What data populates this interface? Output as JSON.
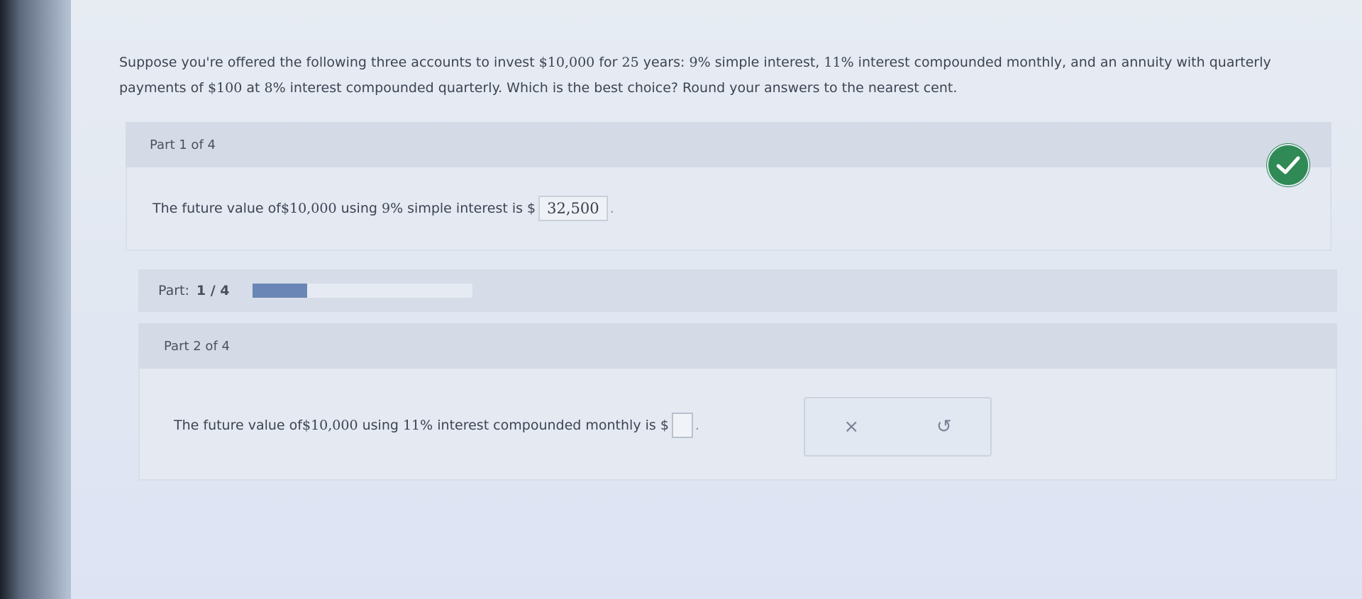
{
  "question": {
    "segments": [
      {
        "t": "Suppose you're offered the following three accounts to invest ",
        "n": false
      },
      {
        "t": "$10,000",
        "n": true
      },
      {
        "t": " for ",
        "n": false
      },
      {
        "t": "25",
        "n": true
      },
      {
        "t": " years: ",
        "n": false
      },
      {
        "t": "9",
        "n": true
      },
      {
        "t": "% simple interest, ",
        "n": false
      },
      {
        "t": "11",
        "n": true
      },
      {
        "t": "% interest compounded monthly, and an annuity with quarterly payments of ",
        "n": false
      },
      {
        "t": "$100",
        "n": true
      },
      {
        "t": " at ",
        "n": false
      },
      {
        "t": "8",
        "n": true
      },
      {
        "t": "% interest compounded quarterly. Which is the best choice? Round your answers to the nearest cent.",
        "n": false
      }
    ]
  },
  "part1": {
    "header": "Part 1 of 4",
    "text_prefix": "The future value of ",
    "amount": "$10,000",
    "text_mid": " using ",
    "rate": "9",
    "text_suffix": "% simple interest is $",
    "answer": "32,500",
    "trail": ".",
    "status_icon": "check-icon",
    "status_color": "#2f8a55"
  },
  "progress": {
    "label": "Part:",
    "value": "1 / 4",
    "fraction": 0.25
  },
  "part2": {
    "header": "Part 2 of 4",
    "text_prefix": "The future value of ",
    "amount": "$10,000",
    "text_mid": " using ",
    "rate": "11",
    "text_suffix": "% interest compounded monthly is $",
    "answer": "",
    "trail": "."
  },
  "tools": {
    "clear_glyph": "×",
    "undo_glyph": "↺",
    "clear_icon": "close-icon",
    "undo_icon": "undo-icon"
  }
}
